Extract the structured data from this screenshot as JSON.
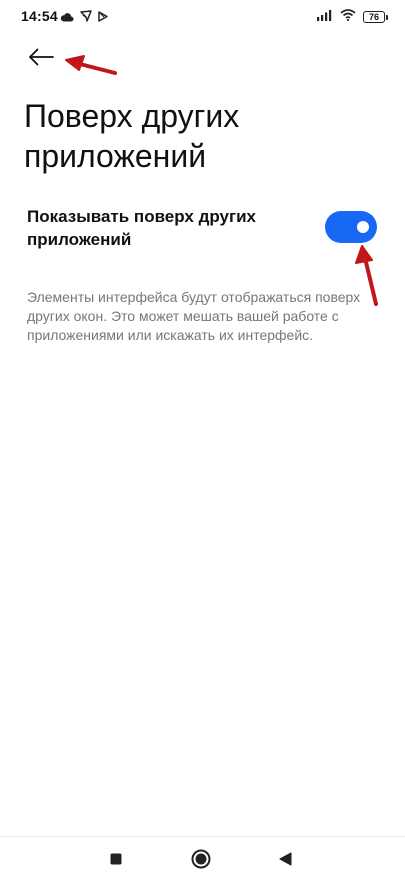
{
  "status_bar": {
    "time": "14:54",
    "battery_level": "76",
    "left_icons": [
      "cloud-icon",
      "signal-app-icon",
      "play-store-icon"
    ],
    "right_icons": [
      "cellular-signal-icon",
      "wifi-icon",
      "battery-icon"
    ]
  },
  "header": {
    "back_icon": "arrow-left-icon",
    "title": "Поверх других приложений"
  },
  "setting": {
    "label": "Показывать поверх других приложений",
    "enabled": true,
    "toggle_color": "#1769f5"
  },
  "description": "Элементы интерфейса будут отображаться поверх других окон. Это может мешать вашей работе с приложениями или искажать их интерфейс.",
  "nav_bar": {
    "buttons": [
      "recents-square-icon",
      "home-circle-icon",
      "back-triangle-icon"
    ]
  },
  "annotation_color": "#c0161c"
}
